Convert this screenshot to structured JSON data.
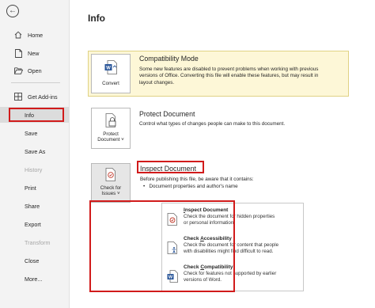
{
  "sidebar": {
    "items": [
      {
        "label": "Home",
        "icon": "home-icon",
        "enabled": true
      },
      {
        "label": "New",
        "icon": "new-document-icon",
        "enabled": true
      },
      {
        "label": "Open",
        "icon": "folder-open-icon",
        "enabled": true
      },
      {
        "label": "Get Add-ins",
        "icon": "grid-icon",
        "enabled": true
      },
      {
        "label": "Info",
        "enabled": true,
        "selected": true
      },
      {
        "label": "Save",
        "enabled": true
      },
      {
        "label": "Save As",
        "enabled": true
      },
      {
        "label": "History",
        "enabled": false
      },
      {
        "label": "Print",
        "enabled": true
      },
      {
        "label": "Share",
        "enabled": true
      },
      {
        "label": "Export",
        "enabled": true
      },
      {
        "label": "Transform",
        "enabled": false
      },
      {
        "label": "Close",
        "enabled": true
      },
      {
        "label": "More...",
        "enabled": true
      }
    ]
  },
  "main": {
    "title": "Info",
    "compatibility": {
      "button_label": "Convert",
      "title": "Compatibility Mode",
      "desc_lines": [
        "Some new features are disabled to prevent problems when working with previous",
        "versions of Office. Converting this file will enable these features, but may result in",
        "layout changes."
      ]
    },
    "protect": {
      "button_line1": "Protect",
      "button_line2": "Document ˅",
      "title": "Protect Document",
      "desc": "Control what types of changes people can make to this document."
    },
    "inspect": {
      "button_line1": "Check for",
      "button_line2": "Issues ˅",
      "title": "Inspect Document",
      "desc": "Before publishing this file, be aware that it contains:",
      "bullet": "Document properties and author's name"
    },
    "dropdown": [
      {
        "title_key": "I",
        "title_rest": "nspect Document",
        "desc_lines": [
          "Check the document for hidden properties",
          "or personal information."
        ]
      },
      {
        "title_pre": "Check ",
        "title_key": "A",
        "title_rest": "ccessibility",
        "desc_lines": [
          "Check the document for content that people",
          "with disabilities might find difficult to read."
        ]
      },
      {
        "title_pre": "Check ",
        "title_key": "C",
        "title_rest": "ompatibility",
        "desc_lines": [
          "Check for features not supported by earlier",
          "versions of Word."
        ]
      }
    ]
  },
  "colors": {
    "highlight_red": "#d11b1b",
    "compat_background": "#fdf7d7",
    "word_blue": "#2b579a"
  }
}
